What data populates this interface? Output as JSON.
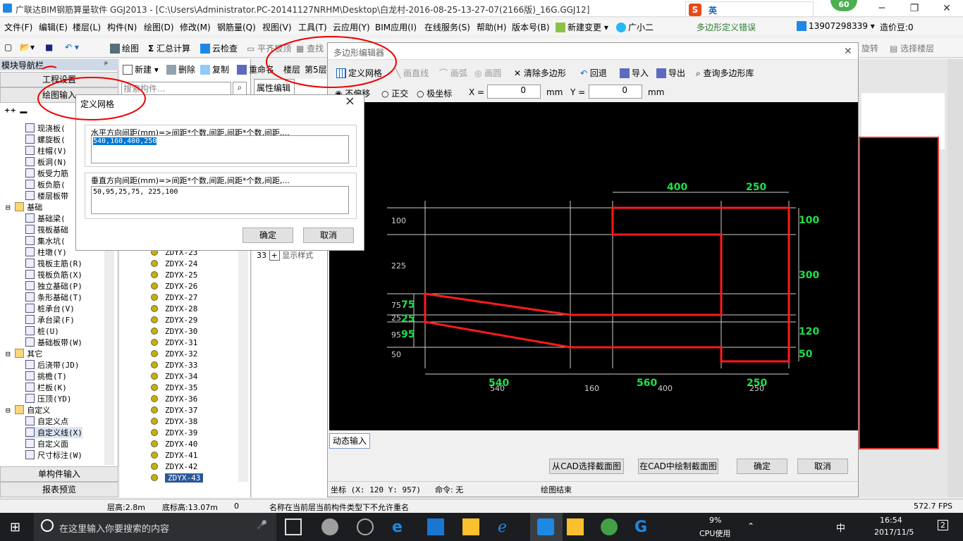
{
  "window": {
    "title": "广联达BIM钢筋算量软件 GGJ2013 - [C:\\Users\\Administrator.PC-20141127NRHM\\Desktop\\白龙村-2016-08-25-13-27-07(2166版)_16G.GGJ12]",
    "badge": "60",
    "ime_label": "英"
  },
  "menubar": {
    "items": [
      "文件(F)",
      "编辑(E)",
      "楼层(L)",
      "构件(N)",
      "绘图(D)",
      "修改(M)",
      "钢筋量(Q)",
      "视图(V)",
      "工具(T)",
      "云应用(Y)",
      "BIM应用(I)",
      "在线服务(S)",
      "帮助(H)",
      "版本号(B)",
      "新建变更",
      "广小二"
    ],
    "notice": "多边形定义错误",
    "phone": "13907298339",
    "points": "造价豆:0"
  },
  "toolbar": {
    "draw": "绘图",
    "sum": "汇总计算",
    "cloud": "云检查",
    "floor_align": "平齐板顶",
    "find": "查找",
    "rotate": "旋转",
    "select_floor": "选择楼层"
  },
  "nav": {
    "title": "模块导航栏",
    "pin": "# ×",
    "project_settings": "工程设置",
    "drawing_input": "绘图输入",
    "single_input": "单构件输入",
    "report": "报表预览",
    "tree": [
      {
        "indent": 36,
        "label": "现浇板(",
        "icon": "slab-icon"
      },
      {
        "indent": 36,
        "label": "螺旋板(",
        "icon": "spiral-icon"
      },
      {
        "indent": 36,
        "label": "柱帽(V)",
        "icon": "column-cap-icon"
      },
      {
        "indent": 36,
        "label": "板洞(N)",
        "icon": "hole-icon"
      },
      {
        "indent": 36,
        "label": "板受力筋",
        "icon": "rebar-icon"
      },
      {
        "indent": 36,
        "label": "板负筋(",
        "icon": "rebar-icon"
      },
      {
        "indent": 36,
        "label": "楼层板带",
        "icon": "strip-icon"
      },
      {
        "indent": 8,
        "label": "基础",
        "icon": "folder-icon",
        "group": true
      },
      {
        "indent": 36,
        "label": "基础梁(",
        "icon": "beam-icon"
      },
      {
        "indent": 36,
        "label": "筏板基础",
        "icon": "raft-icon"
      },
      {
        "indent": 36,
        "label": "集水坑(",
        "icon": "sump-icon"
      },
      {
        "indent": 36,
        "label": "柱墩(Y)",
        "icon": "pier-icon"
      },
      {
        "indent": 36,
        "label": "筏板主筋(R)",
        "icon": "rebar-icon"
      },
      {
        "indent": 36,
        "label": "筏板负筋(X)",
        "icon": "rebar-icon"
      },
      {
        "indent": 36,
        "label": "独立基础(P)",
        "icon": "footing-icon"
      },
      {
        "indent": 36,
        "label": "条形基础(T)",
        "icon": "strip-footing-icon"
      },
      {
        "indent": 36,
        "label": "桩承台(V)",
        "icon": "pile-cap-icon"
      },
      {
        "indent": 36,
        "label": "承台梁(F)",
        "icon": "beam-icon"
      },
      {
        "indent": 36,
        "label": "桩(U)",
        "icon": "pile-icon"
      },
      {
        "indent": 36,
        "label": "基础板带(W)",
        "icon": "strip-icon"
      },
      {
        "indent": 8,
        "label": "其它",
        "icon": "folder-icon",
        "group": true
      },
      {
        "indent": 36,
        "label": "后浇带(JD)",
        "icon": "post-pour-icon"
      },
      {
        "indent": 36,
        "label": "挑檐(T)",
        "icon": "eave-icon"
      },
      {
        "indent": 36,
        "label": "栏板(K)",
        "icon": "parapet-icon"
      },
      {
        "indent": 36,
        "label": "压顶(YD)",
        "icon": "coping-icon"
      },
      {
        "indent": 8,
        "label": "自定义",
        "icon": "folder-icon",
        "group": true
      },
      {
        "indent": 36,
        "label": "自定义点",
        "icon": "custom-point-icon"
      },
      {
        "indent": 36,
        "label": "自定义线(X)",
        "icon": "custom-line-icon",
        "selected": true
      },
      {
        "indent": 36,
        "label": "自定义面",
        "icon": "custom-face-icon"
      },
      {
        "indent": 36,
        "label": "尺寸标注(W)",
        "icon": "dimension-icon"
      }
    ]
  },
  "list": {
    "new": "新建",
    "delete": "删除",
    "copy": "复制",
    "rename": "重命名",
    "floor": "楼层",
    "floor5": "第5层",
    "search_placeholder": "搜索构件...",
    "props_tab": "属性编辑",
    "row33": "33",
    "show_style": "显示样式",
    "items": [
      "ZDYX-23",
      "ZDYX-24",
      "ZDYX-25",
      "ZDYX-26",
      "ZDYX-27",
      "ZDYX-28",
      "ZDYX-29",
      "ZDYX-30",
      "ZDYX-31",
      "ZDYX-32",
      "ZDYX-33",
      "ZDYX-34",
      "ZDYX-35",
      "ZDYX-36",
      "ZDYX-37",
      "ZDYX-38",
      "ZDYX-39",
      "ZDYX-40",
      "ZDYX-41",
      "ZDYX-42",
      "ZDYX-43"
    ],
    "selected": "ZDYX-43"
  },
  "poly": {
    "title": "多边形编辑器",
    "define_grid": "定义网格",
    "line": "画直线",
    "arc": "画弧",
    "circle": "画圆",
    "clear": "清除多边形",
    "undo": "回退",
    "import": "导入",
    "export": "导出",
    "query": "查询多边形库",
    "no_offset": "不偏移",
    "ortho": "正交",
    "polar": "极坐标",
    "x_label": "X =",
    "x_val": "0",
    "mm": "mm",
    "y_label": "Y =",
    "y_val": "0",
    "dynamic": "动态输入",
    "from_cad": "从CAD选择截面图",
    "draw_cad": "在CAD中绘制截面图",
    "ok": "确定",
    "cancel": "取消",
    "coords": "坐标 (X: 120 Y: 957)",
    "command": "命令: 无",
    "draw_end": "绘图结束",
    "canvas": {
      "dim_top": [
        "400",
        "250"
      ],
      "dim_bottom_green": [
        "540",
        "560",
        "250"
      ],
      "dim_bottom_white": [
        "540",
        "160",
        "400",
        "250"
      ],
      "dim_left_white": [
        "100",
        "225",
        "75",
        "25",
        "95",
        "50"
      ],
      "dim_left_green": [
        "75",
        "25",
        "95"
      ],
      "dim_right": [
        "100",
        "300",
        "120",
        "50"
      ]
    }
  },
  "grid_dialog": {
    "title": "定义网格",
    "close": "×",
    "h_label": "水平方向间距(mm)=>间距*个数,间距,间距*个数,间距,...",
    "h_value": "540,160,400,250",
    "v_label": "垂直方向间距(mm)=>间距*个数,间距,间距*个数,间距,...",
    "v_value": "50,95,25,75, 225,100",
    "ok": "确定",
    "cancel": "取消"
  },
  "status": {
    "floor_height": "层高:2.8m",
    "base_height": "底标高:13.07m",
    "zero": "0",
    "message": "名称在当前层当前构件类型下不允许重名",
    "fps": "572.7 FPS"
  },
  "taskbar": {
    "search": "在这里输入你要搜索的内容",
    "cpu": "9%",
    "cpu_label": "CPU使用",
    "lang": "中",
    "time": "16:54",
    "date": "2017/11/5",
    "notif": "2"
  }
}
